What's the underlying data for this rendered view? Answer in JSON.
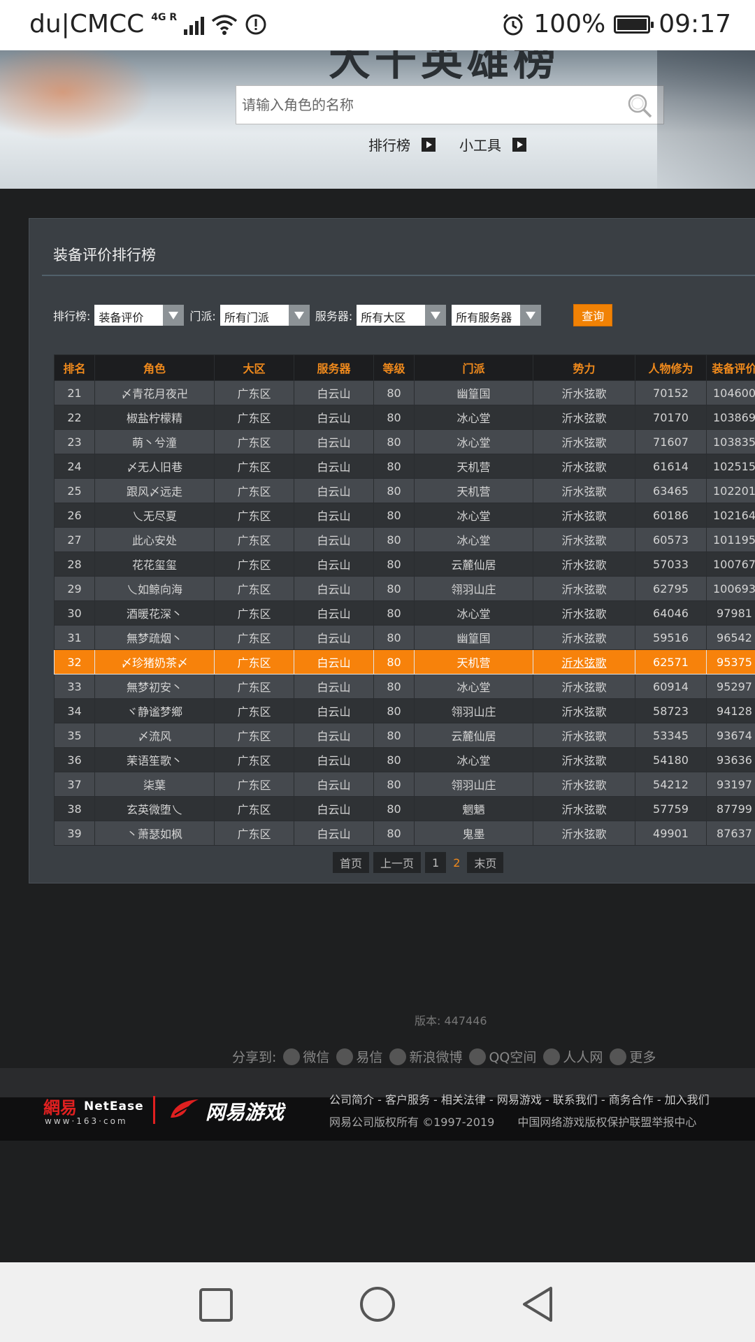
{
  "status": {
    "carrier": "du|CMCC",
    "network": "4G R",
    "battery": "100%",
    "time": "09:17"
  },
  "banner": {
    "title": "大千英雄榜",
    "search_placeholder": "请输入角色的名称",
    "tabs": [
      "排行榜",
      "小工具"
    ]
  },
  "panel": {
    "title": "装备评价排行榜",
    "filters": {
      "rank_label": "排行榜:",
      "rank_value": "装备评价",
      "sect_label": "门派:",
      "sect_value": "所有门派",
      "server_label": "服务器:",
      "region_value": "所有大区",
      "server_value": "所有服务器",
      "query": "查询"
    },
    "columns": [
      "排名",
      "角色",
      "大区",
      "服务器",
      "等级",
      "门派",
      "势力",
      "人物修为",
      "装备评价"
    ],
    "rows": [
      [
        "21",
        "〆青花月夜卍",
        "广东区",
        "白云山",
        "80",
        "幽篁国",
        "沂水弦歌",
        "70152",
        "104600"
      ],
      [
        "22",
        "椒盐柠檬精",
        "广东区",
        "白云山",
        "80",
        "冰心堂",
        "沂水弦歌",
        "70170",
        "103869"
      ],
      [
        "23",
        "萌丶兮潼",
        "广东区",
        "白云山",
        "80",
        "冰心堂",
        "沂水弦歌",
        "71607",
        "103835"
      ],
      [
        "24",
        "〆无人旧巷",
        "广东区",
        "白云山",
        "80",
        "天机营",
        "沂水弦歌",
        "61614",
        "102515"
      ],
      [
        "25",
        "跟风〆远走",
        "广东区",
        "白云山",
        "80",
        "天机营",
        "沂水弦歌",
        "63465",
        "102201"
      ],
      [
        "26",
        "乀无尽夏",
        "广东区",
        "白云山",
        "80",
        "冰心堂",
        "沂水弦歌",
        "60186",
        "102164"
      ],
      [
        "27",
        "此心安处",
        "广东区",
        "白云山",
        "80",
        "冰心堂",
        "沂水弦歌",
        "60573",
        "101195"
      ],
      [
        "28",
        "花花玺玺",
        "广东区",
        "白云山",
        "80",
        "云麓仙居",
        "沂水弦歌",
        "57033",
        "100767"
      ],
      [
        "29",
        "乀如鲸向海",
        "广东区",
        "白云山",
        "80",
        "翎羽山庄",
        "沂水弦歌",
        "62795",
        "100693"
      ],
      [
        "30",
        "酒暖花深丶",
        "广东区",
        "白云山",
        "80",
        "冰心堂",
        "沂水弦歌",
        "64046",
        "97981"
      ],
      [
        "31",
        "無梦疏烟丶",
        "广东区",
        "白云山",
        "80",
        "幽篁国",
        "沂水弦歌",
        "59516",
        "96542"
      ],
      [
        "32",
        "〆珍猪奶茶〆",
        "广东区",
        "白云山",
        "80",
        "天机营",
        "沂水弦歌",
        "62571",
        "95375"
      ],
      [
        "33",
        "無梦初安丶",
        "广东区",
        "白云山",
        "80",
        "冰心堂",
        "沂水弦歌",
        "60914",
        "95297"
      ],
      [
        "34",
        "ヾ静谧梦鄉",
        "广东区",
        "白云山",
        "80",
        "翎羽山庄",
        "沂水弦歌",
        "58723",
        "94128"
      ],
      [
        "35",
        "〆流风",
        "广东区",
        "白云山",
        "80",
        "云麓仙居",
        "沂水弦歌",
        "53345",
        "93674"
      ],
      [
        "36",
        "茉语笙歌丶",
        "广东区",
        "白云山",
        "80",
        "冰心堂",
        "沂水弦歌",
        "54180",
        "93636"
      ],
      [
        "37",
        "柒葉",
        "广东区",
        "白云山",
        "80",
        "翎羽山庄",
        "沂水弦歌",
        "54212",
        "93197"
      ],
      [
        "38",
        "玄英微堕乀",
        "广东区",
        "白云山",
        "80",
        "魍魉",
        "沂水弦歌",
        "57759",
        "87799"
      ],
      [
        "39",
        "丶萧瑟如枫",
        "广东区",
        "白云山",
        "80",
        "鬼墨",
        "沂水弦歌",
        "49901",
        "87637"
      ]
    ],
    "highlight_rank": "32",
    "pager": [
      "首页",
      "上一页",
      "1",
      "2",
      "末页"
    ],
    "current_page": "2"
  },
  "footer": {
    "version": "版本: 447446",
    "share_label": "分享到:",
    "share_items": [
      "微信",
      "易信",
      "新浪微博",
      "QQ空间",
      "人人网",
      "更多"
    ],
    "logo_netease_cn": "網易",
    "logo_netease_en": "NetEase",
    "logo_netease_url": "www·163·com",
    "logo_games": "网易游戏",
    "links": "公司简介 - 客户服务 - 相关法律 - 网易游戏 - 联系我们 - 商务合作 - 加入我们",
    "copyright": "网易公司版权所有 ©1997-2019",
    "report": "中国网络游戏版权保护联盟举报中心"
  },
  "colors": {
    "accent": "#f7820b",
    "header_text": "#f08a1c",
    "panel_bg": "#3a3f44"
  }
}
